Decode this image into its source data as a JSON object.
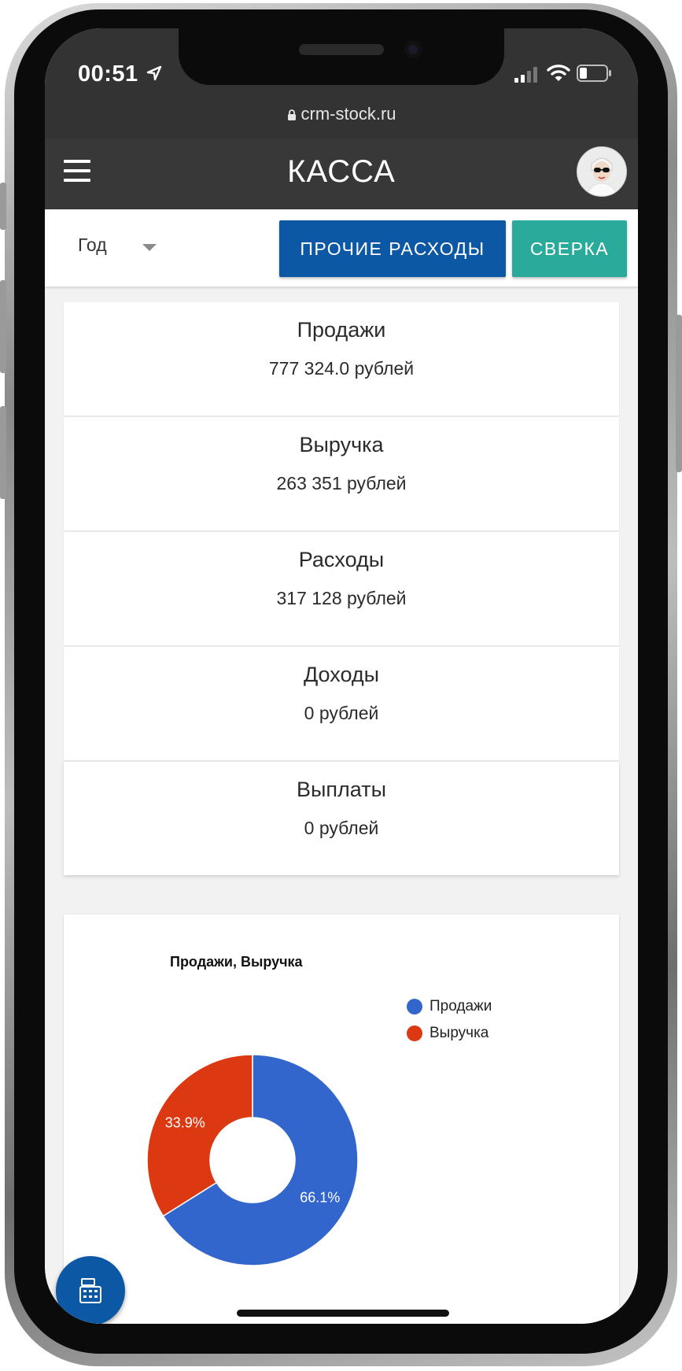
{
  "status_bar": {
    "time": "00:51",
    "url": "crm-stock.ru"
  },
  "header": {
    "title": "КАССА"
  },
  "toolbar": {
    "period_selected": "Год",
    "expenses_button": "ПРОЧИЕ РАСХОДЫ",
    "reconcile_button": "СВЕРКА"
  },
  "stats": [
    {
      "label": "Продажи",
      "value": "777 324.0 рублей"
    },
    {
      "label": "Выручка",
      "value": "263 351 рублей"
    },
    {
      "label": "Расходы",
      "value": "317 128 рублей"
    },
    {
      "label": "Доходы",
      "value": "0 рублей"
    },
    {
      "label": "Выплаты",
      "value": "0 рублей"
    }
  ],
  "chart_data": {
    "type": "pie",
    "donut": true,
    "title": "Продажи, Выручка",
    "legend_position": "top-right",
    "categories": [
      "Продажи",
      "Выручка"
    ],
    "values": [
      66.1,
      33.9
    ],
    "labels": [
      "66.1%",
      "33.9%"
    ],
    "colors": [
      "#3366cc",
      "#dc3912"
    ]
  },
  "colors": {
    "primary_button": "#0d58a4",
    "secondary_button": "#2aaa9a",
    "header_bg": "#383838"
  },
  "icons": {
    "menu": "menu-icon",
    "fab": "calculator-icon",
    "avatar": "avatar"
  }
}
